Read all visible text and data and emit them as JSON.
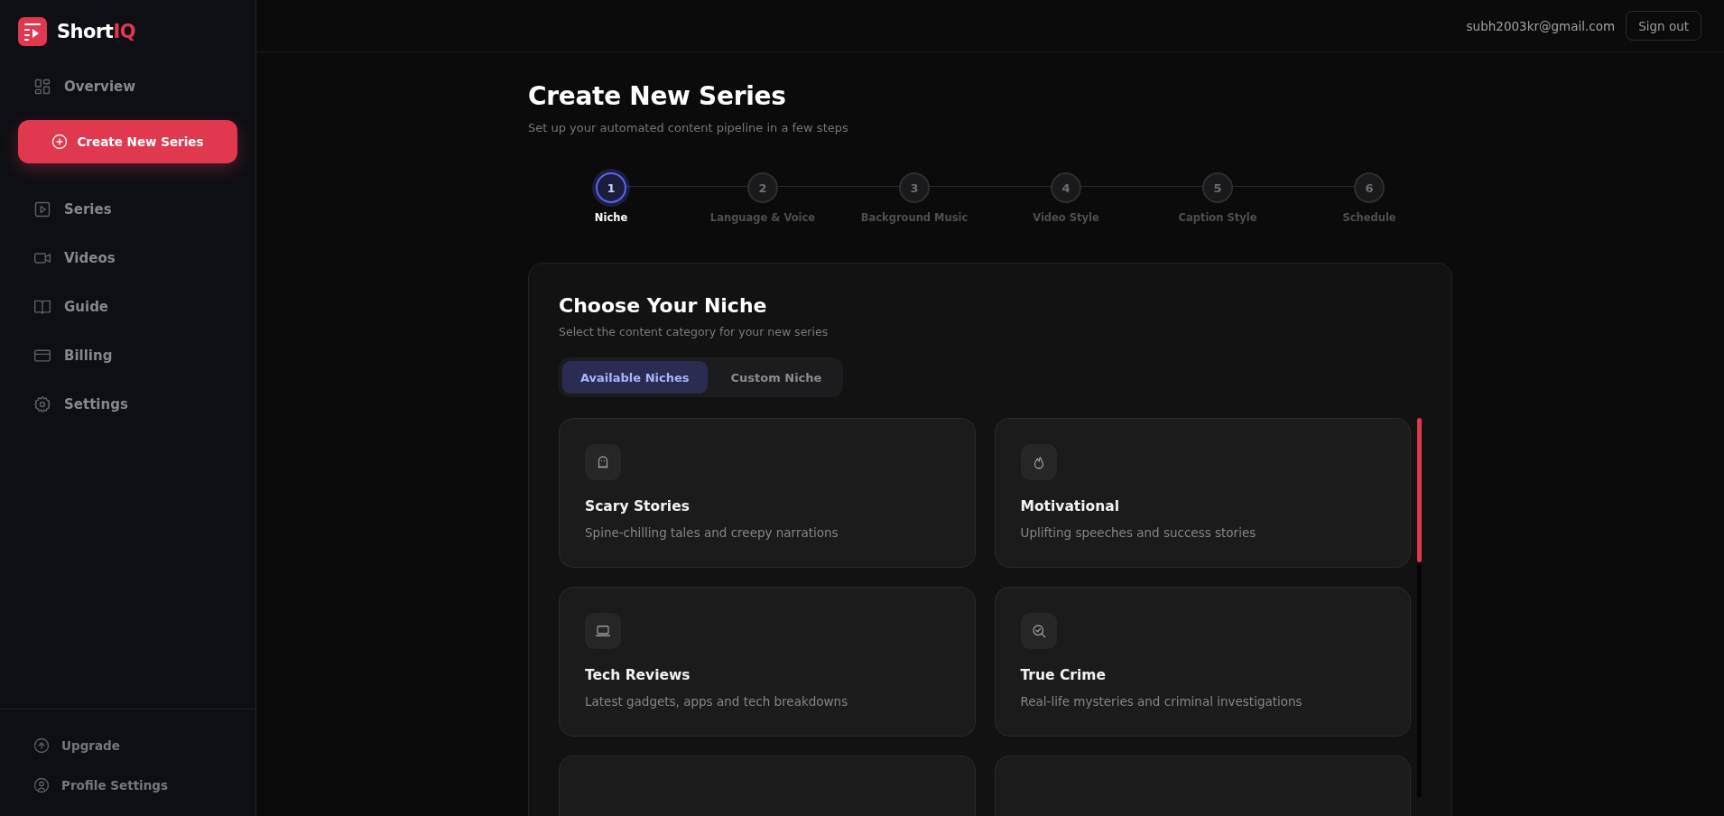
{
  "brand": {
    "name": "Short",
    "accent": "IQ"
  },
  "sidebar": {
    "overview": "Overview",
    "create_button": "Create New Series",
    "items": [
      {
        "label": "Series"
      },
      {
        "label": "Videos"
      },
      {
        "label": "Guide"
      },
      {
        "label": "Billing"
      },
      {
        "label": "Settings"
      }
    ],
    "footer_items": [
      {
        "label": "Upgrade"
      },
      {
        "label": "Profile Settings"
      }
    ]
  },
  "header": {
    "email": "subh2003kr@gmail.com",
    "sign_out": "Sign out"
  },
  "page": {
    "title": "Create New Series",
    "subtitle": "Set up your automated content pipeline in a few steps"
  },
  "steps": [
    {
      "number": "1",
      "label": "Niche",
      "selected": true
    },
    {
      "number": "2",
      "label": "Language & Voice",
      "selected": false
    },
    {
      "number": "3",
      "label": "Background Music",
      "selected": false
    },
    {
      "number": "4",
      "label": "Video Style",
      "selected": false
    },
    {
      "number": "5",
      "label": "Caption Style",
      "selected": false
    },
    {
      "number": "6",
      "label": "Schedule",
      "selected": false
    }
  ],
  "panel": {
    "title": "Choose Your Niche",
    "subtitle": "Select the content category for your new series",
    "tabs": [
      {
        "label": "Available Niches",
        "selected": true
      },
      {
        "label": "Custom Niche",
        "selected": false
      }
    ],
    "niches": [
      {
        "kind": "full",
        "title": "Scary Stories",
        "description": "Spine-chilling tales and creepy narrations"
      },
      {
        "kind": "full",
        "title": "Motivational",
        "description": "Uplifting speeches and success stories"
      },
      {
        "kind": "full",
        "title": "Tech Reviews",
        "description": "Latest gadgets, apps and tech breakdowns"
      },
      {
        "kind": "full",
        "title": "True Crime",
        "description": "Real-life mysteries and criminal investigations"
      },
      {
        "kind": "partial"
      },
      {
        "kind": "partial"
      }
    ]
  }
}
